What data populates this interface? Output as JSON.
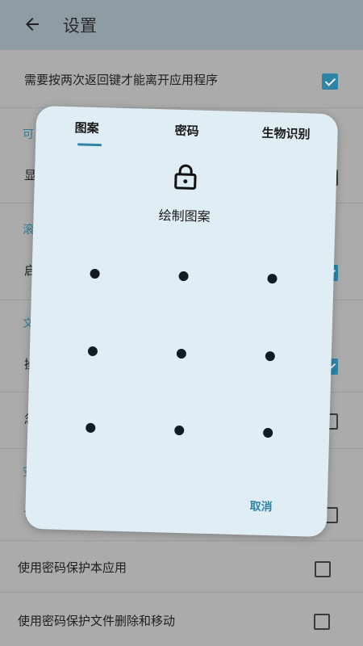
{
  "appbar": {
    "title": "设置",
    "back_icon": "arrow-left-icon"
  },
  "settings": {
    "rows": [
      {
        "label": "需要按两次返回键才能离开应用程序",
        "checked": true
      },
      {
        "section": "可"
      },
      {
        "label": "显",
        "checked": false
      },
      {
        "section": "滚"
      },
      {
        "label": "启",
        "checked": true
      },
      {
        "section": "文"
      },
      {
        "label": "操",
        "checked": true
      },
      {
        "label": "忽",
        "checked": false
      },
      {
        "section": "安"
      },
      {
        "label": "使",
        "checked": false
      },
      {
        "label": "使用密码保护本应用",
        "checked": false
      },
      {
        "label": "使用密码保护文件删除和移动",
        "checked": false
      }
    ]
  },
  "dialog": {
    "tabs": [
      "图案",
      "密码",
      "生物识别"
    ],
    "active_tab": "图案",
    "lock_icon": "lock-icon",
    "prompt": "绘制图案",
    "cancel_label": "取消",
    "accent_color": "#2f84a6"
  }
}
